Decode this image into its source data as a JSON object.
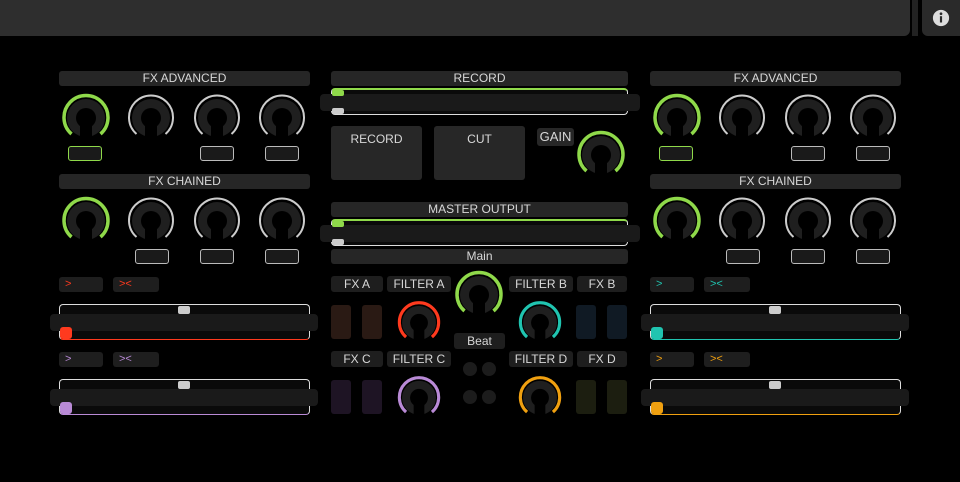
{
  "info_icon": "info-icon",
  "left": {
    "fx_advanced_title": "FX ADVANCED",
    "fx_chained_title": "FX CHAINED",
    "tag_red_1": ">",
    "tag_red_2": "><",
    "tag_violet_1": ">",
    "tag_violet_2": "><"
  },
  "center": {
    "record_title": "RECORD",
    "record_pad": "RECORD",
    "cut_pad": "CUT",
    "gain_label": "GAIN",
    "master_output_title": "MASTER OUTPUT",
    "main_label": "Main",
    "fx_a": "FX A",
    "filter_a": "FILTER A",
    "filter_b": "FILTER B",
    "fx_b": "FX B",
    "beat_label": "Beat",
    "fx_c": "FX C",
    "filter_c": "FILTER C",
    "filter_d": "FILTER D",
    "fx_d": "FX D"
  },
  "right": {
    "fx_advanced_title": "FX ADVANCED",
    "fx_chained_title": "FX CHAINED",
    "tag_cyan_1": ">",
    "tag_cyan_2": "><",
    "tag_orange_1": ">",
    "tag_orange_2": "><"
  },
  "colors": {
    "green": "#8fd94a",
    "red": "#ff3a1e",
    "violet": "#b98ad6",
    "cyan": "#20c4b0",
    "orange": "#f0a010",
    "white": "#dddddd"
  }
}
